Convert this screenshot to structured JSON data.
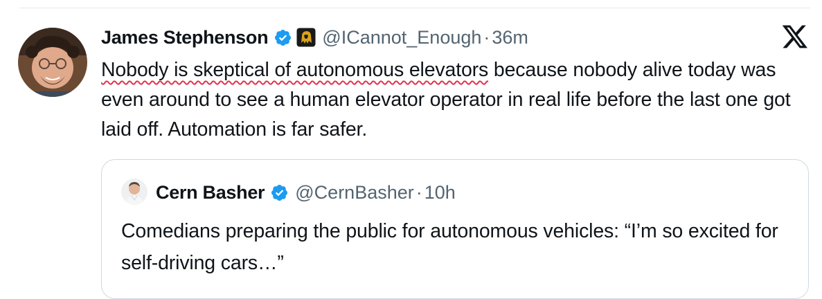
{
  "tweet": {
    "author_name": "James Stephenson",
    "handle": "@ICannot_Enough",
    "separator": "·",
    "time": "36m",
    "text_underlined": "Nobody is skeptical of autonomous elevators",
    "text_rest": " because nobody alive today was even around to see a human elevator operator in real life before the last one got laid off. Automation is far safer."
  },
  "quote": {
    "author_name": "Cern Basher",
    "handle": "@CernBasher",
    "separator": "·",
    "time": "10h",
    "text": "Comedians preparing the public for autonomous vehicles: “I’m so excited for self-driving cars…”"
  },
  "icons": {
    "verified": "verified-badge-icon",
    "affiliate": "lion-badge-icon",
    "platform": "x-logo-icon"
  },
  "colors": {
    "verified_blue": "#1d9bf0",
    "secondary_text": "#536471",
    "spellcheck_underline": "#e0334f",
    "border": "#cfd9de"
  }
}
